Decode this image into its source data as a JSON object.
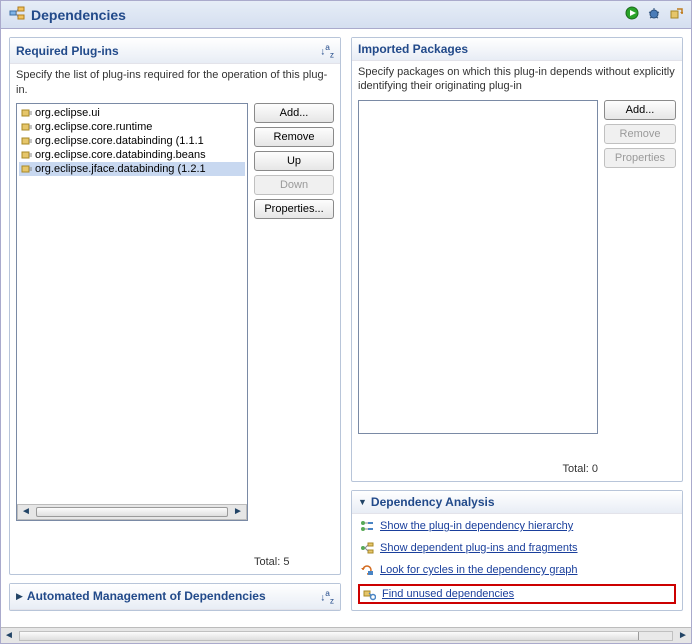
{
  "title": "Dependencies",
  "sections": {
    "required": {
      "title": "Required Plug-ins",
      "desc": "Specify the list of plug-ins required for the operation of this plug-in.",
      "items": [
        "org.eclipse.ui",
        "org.eclipse.core.runtime",
        "org.eclipse.core.databinding (1.1.1",
        "org.eclipse.core.databinding.beans",
        "org.eclipse.jface.databinding (1.2.1"
      ],
      "buttons": {
        "add": "Add...",
        "remove": "Remove",
        "up": "Up",
        "down": "Down",
        "props": "Properties..."
      },
      "total": "Total: 5"
    },
    "imported": {
      "title": "Imported Packages",
      "desc": "Specify packages on which this plug-in depends without explicitly identifying their originating plug-in",
      "buttons": {
        "add": "Add...",
        "remove": "Remove",
        "props": "Properties"
      },
      "total": "Total: 0"
    },
    "analysis": {
      "title": "Dependency Analysis",
      "links": {
        "hierarchy": "Show the plug-in dependency hierarchy",
        "fragments": "Show dependent plug-ins and fragments",
        "cycles": "Look for cycles in the dependency graph",
        "unused": "Find unused dependencies"
      }
    },
    "automated": {
      "title": "Automated Management of Dependencies"
    }
  }
}
